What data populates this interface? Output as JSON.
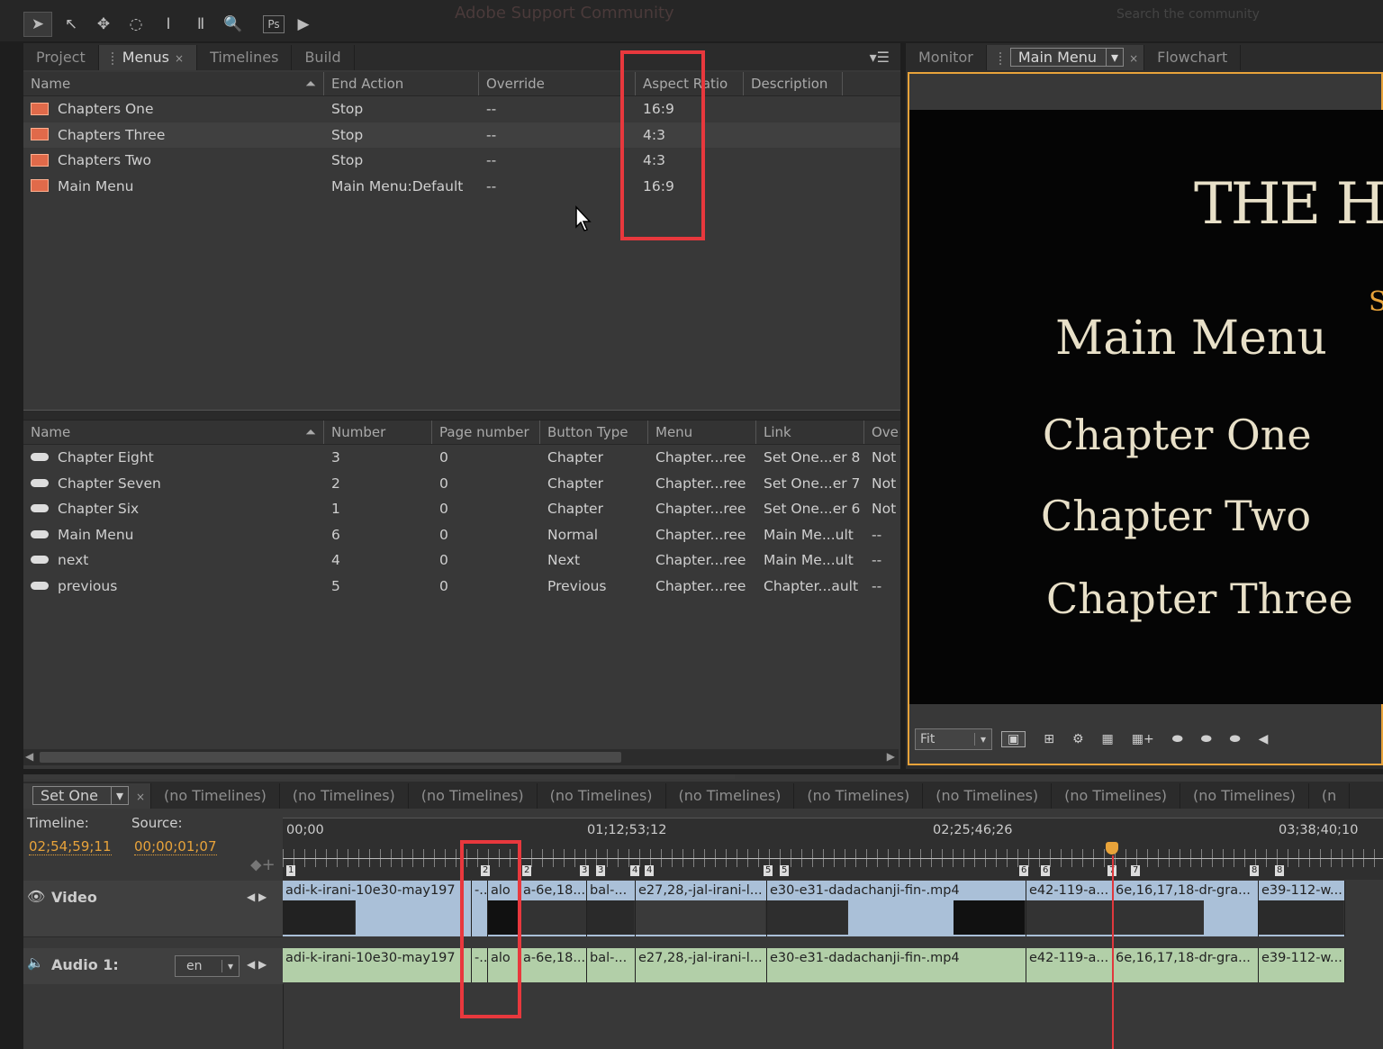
{
  "toolbar": {
    "ghost_title": "Adobe Support Community",
    "ghost_search": "Search the community"
  },
  "project_panel": {
    "tabs": [
      {
        "label": "Project"
      },
      {
        "label": "Menus",
        "close": "×"
      },
      {
        "label": "Timelines"
      },
      {
        "label": "Build"
      }
    ],
    "menus_table": {
      "columns": [
        "Name",
        "End Action",
        "Override",
        "Aspect Ratio",
        "Description"
      ],
      "rows": [
        {
          "name": "Chapters One",
          "end_action": "Stop",
          "override": "--",
          "aspect": "16:9"
        },
        {
          "name": "Chapters Three",
          "end_action": "Stop",
          "override": "--",
          "aspect": "4:3"
        },
        {
          "name": "Chapters Two",
          "end_action": "Stop",
          "override": "--",
          "aspect": "4:3"
        },
        {
          "name": "Main Menu",
          "end_action": "Main Menu:Default",
          "override": "--",
          "aspect": "16:9"
        }
      ]
    },
    "buttons_table": {
      "columns": [
        "Name",
        "Number",
        "Page number",
        "Button Type",
        "Menu",
        "Link",
        "Ove"
      ],
      "rows": [
        {
          "name": "Chapter Eight",
          "number": "3",
          "page": "0",
          "type": "Chapter",
          "menu": "Chapter...ree",
          "link": "Set One...er 8",
          "ove": "Not"
        },
        {
          "name": "Chapter Seven",
          "number": "2",
          "page": "0",
          "type": "Chapter",
          "menu": "Chapter...ree",
          "link": "Set One...er 7",
          "ove": "Not"
        },
        {
          "name": "Chapter Six",
          "number": "1",
          "page": "0",
          "type": "Chapter",
          "menu": "Chapter...ree",
          "link": "Set One...er 6",
          "ove": "Not"
        },
        {
          "name": "Main Menu",
          "number": "6",
          "page": "0",
          "type": "Normal",
          "menu": "Chapter...ree",
          "link": "Main Me...ult",
          "ove": "--"
        },
        {
          "name": "next",
          "number": "4",
          "page": "0",
          "type": "Next",
          "menu": "Chapter...ree",
          "link": "Main Me...ult",
          "ove": "--"
        },
        {
          "name": "previous",
          "number": "5",
          "page": "0",
          "type": "Previous",
          "menu": "Chapter...ree",
          "link": "Chapter...ault",
          "ove": "--"
        }
      ]
    }
  },
  "monitor_panel": {
    "tabs": [
      {
        "label": "Monitor"
      },
      {
        "label": "Main Menu",
        "close": "×"
      },
      {
        "label": "Flowchart"
      }
    ],
    "preview": {
      "title": "THE HUMA",
      "sub": "S",
      "items": [
        "Main Menu",
        "Chapter One",
        "Chapter Two",
        "Chapter Three"
      ]
    },
    "zoom": "Fit"
  },
  "timeline_panel": {
    "tabs": [
      {
        "label": "Set One",
        "close": "×"
      },
      {
        "label": "(no Timelines)"
      },
      {
        "label": "(no Timelines)"
      },
      {
        "label": "(no Timelines)"
      },
      {
        "label": "(no Timelines)"
      },
      {
        "label": "(no Timelines)"
      },
      {
        "label": "(no Timelines)"
      },
      {
        "label": "(no Timelines)"
      },
      {
        "label": "(no Timelines)"
      },
      {
        "label": "(no Timelines)"
      },
      {
        "label": "(n"
      }
    ],
    "timeline_label": "Timeline:",
    "source_label": "Source:",
    "timeline_time": "02;54;59;11",
    "source_time": "00;00;01;07",
    "ruler": [
      "00;00",
      "01;12;53;12",
      "02;25;46;26",
      "03;38;40;10"
    ],
    "markers": [
      "1",
      "2",
      "2",
      "3",
      "3",
      "4",
      "4",
      "5",
      "5",
      "6",
      "6",
      "7",
      "7",
      "8",
      "8"
    ],
    "video_label": "Video",
    "audio_label": "Audio 1:",
    "audio_lang": "en",
    "clips": [
      "adi-k-irani-10e30-may197",
      "-...",
      "alo",
      "a-6e,18...",
      "bal-...",
      "e27,28,-jal-irani-l...",
      "e30-e31-dadachanji-fin-.mp4",
      "e42-119-a...",
      "6e,16,17,18-dr-gra...",
      "e39-112-w..."
    ]
  },
  "colors": {
    "highlight": "#e8383d",
    "accent": "#e8a33a",
    "timecode": "#e8a33a"
  }
}
